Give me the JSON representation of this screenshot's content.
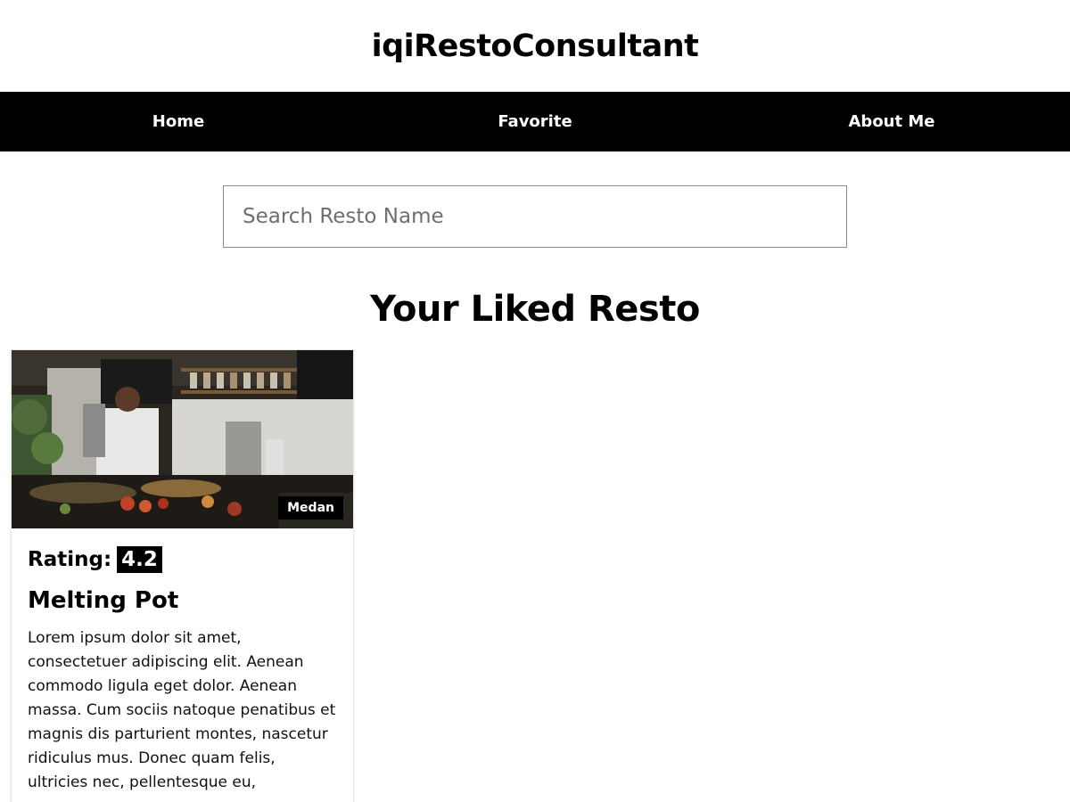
{
  "header": {
    "title": "iqiRestoConsultant"
  },
  "nav": {
    "items": [
      {
        "label": "Home"
      },
      {
        "label": "Favorite"
      },
      {
        "label": "About Me"
      }
    ]
  },
  "search": {
    "placeholder": "Search Resto Name",
    "value": ""
  },
  "section": {
    "title": "Your Liked Resto"
  },
  "restaurants": [
    {
      "city": "Medan",
      "rating_label": "Rating:",
      "rating": "4.2",
      "name": "Melting Pot",
      "description": "Lorem ipsum dolor sit amet, consectetuer adipiscing elit. Aenean commodo ligula eget dolor. Aenean massa. Cum sociis natoque penatibus et magnis dis parturient montes, nascetur ridiculus mus. Donec quam felis, ultricies nec, pellentesque eu,"
    }
  ],
  "colors": {
    "nav_background": "#000000",
    "nav_text": "#ffffff",
    "badge_background": "#000000"
  }
}
